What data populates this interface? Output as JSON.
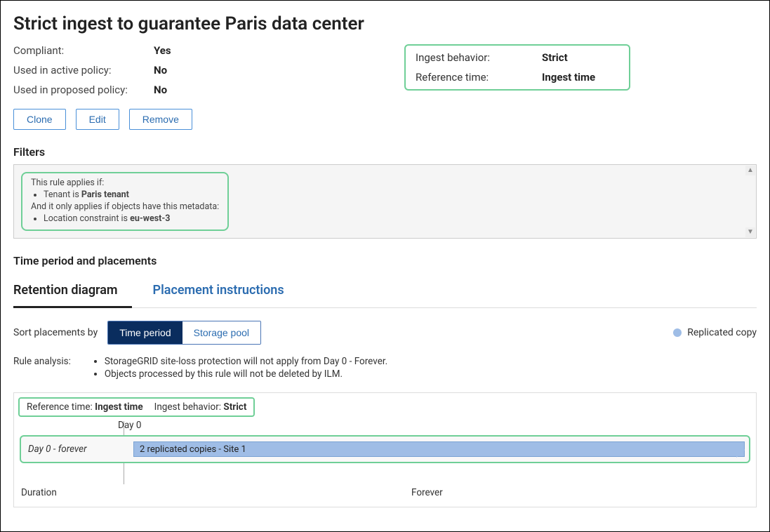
{
  "title": "Strict ingest to guarantee Paris data center",
  "meta_left": {
    "compliant_label": "Compliant:",
    "compliant_value": "Yes",
    "active_label": "Used in active policy:",
    "active_value": "No",
    "proposed_label": "Used in proposed policy:",
    "proposed_value": "No"
  },
  "meta_right": {
    "ingest_label": "Ingest behavior:",
    "ingest_value": "Strict",
    "ref_label": "Reference time:",
    "ref_value": "Ingest time"
  },
  "buttons": {
    "clone": "Clone",
    "edit": "Edit",
    "remove": "Remove"
  },
  "filters": {
    "title": "Filters",
    "line1": "This rule applies if:",
    "bullet1_pre": "Tenant is ",
    "bullet1_bold": "Paris tenant",
    "line2": "And it only applies if objects have this metadata:",
    "bullet2_pre": "Location constraint is ",
    "bullet2_bold": "eu-west-3"
  },
  "placements_title": "Time period and placements",
  "tabs": {
    "retention": "Retention diagram",
    "instructions": "Placement instructions"
  },
  "sort": {
    "label": "Sort placements by",
    "time": "Time period",
    "pool": "Storage pool"
  },
  "legend": "Replicated copy",
  "analysis": {
    "label": "Rule analysis:",
    "item1": "StorageGRID site-loss protection will not apply from Day 0 - Forever.",
    "item2": "Objects processed by this rule will not be deleted by ILM."
  },
  "diagram": {
    "ref_time_label": "Reference time:",
    "ref_time_value": "Ingest time",
    "ingest_label": "Ingest behavior:",
    "ingest_value": "Strict",
    "day0": "Day 0",
    "period_label": "Day 0 - forever",
    "bar_text": "2 replicated copies - Site 1",
    "duration_label": "Duration",
    "duration_value": "Forever"
  }
}
